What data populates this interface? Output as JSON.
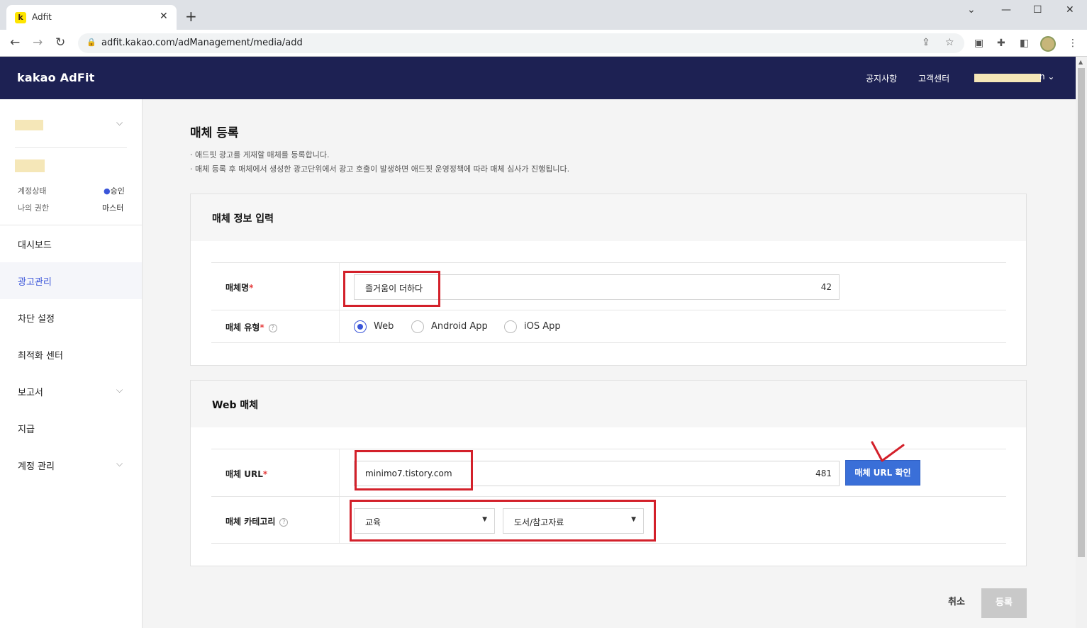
{
  "browser": {
    "tab_title": "Adfit",
    "favicon_letter": "k",
    "url": "adfit.kakao.com/adManagement/media/add"
  },
  "header": {
    "logo": "kakao AdFit",
    "links": [
      "공지사항",
      "고객센터"
    ],
    "user_tail": "n ⌄"
  },
  "sidebar": {
    "account_status_label": "계정상태",
    "account_status_value": "승인",
    "permission_label": "나의 권한",
    "permission_value": "마스터",
    "items": [
      {
        "label": "대시보드"
      },
      {
        "label": "광고관리",
        "active": true
      },
      {
        "label": "차단 설정"
      },
      {
        "label": "최적화 센터"
      },
      {
        "label": "보고서",
        "expandable": true
      },
      {
        "label": "지급"
      },
      {
        "label": "계정 관리",
        "expandable": true
      }
    ]
  },
  "main": {
    "title": "매체 등록",
    "descriptions": [
      "· 애드핏 광고를 게재할 매체를 등록합니다.",
      "· 매체 등록 후 매체에서 생성한 광고단위에서 광고 호출이 발생하면 애드핏 운영정책에 따라 매체 심사가 진행됩니다."
    ],
    "info_panel": {
      "title": "매체 정보 입력",
      "media_name_label": "매체명",
      "media_name_value": "즐거움이 더하다",
      "media_name_count": "42",
      "media_type_label": "매체 유형",
      "media_types": [
        "Web",
        "Android App",
        "iOS App"
      ],
      "selected_type": "Web"
    },
    "web_panel": {
      "title": "Web 매체",
      "url_label": "매체 URL",
      "url_value": "minimo7.tistory.com",
      "url_count": "481",
      "verify_button": "매체 URL 확인",
      "category_label": "매체 카테고리",
      "category_primary": "교육",
      "category_secondary": "도서/참고자료"
    },
    "cancel_button": "취소",
    "submit_button": "등록"
  },
  "colors": {
    "header_bg": "#1d2153",
    "accent": "#3a55d9",
    "verify_button": "#3a6fd8",
    "annotation": "#d3202a"
  }
}
